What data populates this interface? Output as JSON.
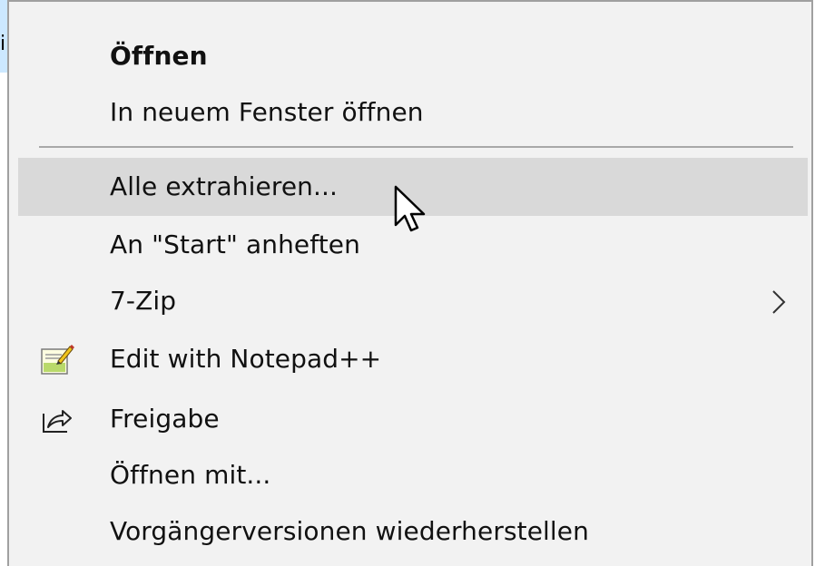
{
  "background_window": {
    "item_fragment": "i"
  },
  "context_menu": {
    "items": [
      {
        "label": "Öffnen",
        "bold": true
      },
      {
        "label": "In neuem Fenster öffnen"
      },
      {
        "label": "Alle extrahieren...",
        "highlighted": true
      },
      {
        "label": "An \"Start\" anheften"
      },
      {
        "label": "7-Zip",
        "has_submenu": true
      },
      {
        "label": "Edit with Notepad++",
        "icon": "notepad-plus-plus-icon"
      },
      {
        "label": "Freigabe",
        "icon": "share-icon"
      },
      {
        "label": "Öffnen mit..."
      },
      {
        "label": "Vorgängerversionen wiederherstellen"
      }
    ]
  },
  "colors": {
    "menu_background": "#f2f2f2",
    "menu_border": "#a0a0a0",
    "hover_background": "#d9d9d9",
    "text": "#111111"
  }
}
